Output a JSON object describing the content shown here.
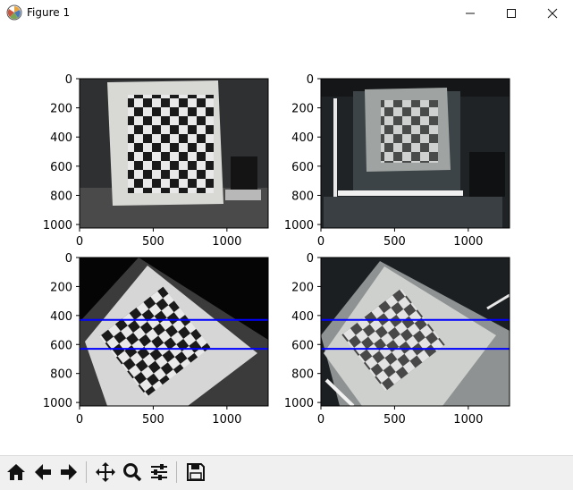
{
  "window": {
    "title": "Figure 1",
    "minimize_icon": "minimize-icon",
    "maximize_icon": "maximize-icon",
    "close_icon": "close-icon"
  },
  "figure": {
    "subplots": [
      {
        "id": "top-left",
        "xticks": [
          "0",
          "500",
          "1000"
        ],
        "yticks": [
          "0",
          "200",
          "400",
          "600",
          "800",
          "1000"
        ],
        "lines": []
      },
      {
        "id": "top-right",
        "xticks": [
          "0",
          "500",
          "1000"
        ],
        "yticks": [
          "0",
          "200",
          "400",
          "600",
          "800",
          "1000"
        ],
        "lines": []
      },
      {
        "id": "bottom-left",
        "xticks": [
          "0",
          "500",
          "1000"
        ],
        "yticks": [
          "0",
          "200",
          "400",
          "600",
          "800",
          "1000"
        ],
        "lines": [
          {
            "y": 430,
            "color": "#0000ff"
          },
          {
            "y": 630,
            "color": "#0000ff"
          }
        ]
      },
      {
        "id": "bottom-right",
        "xticks": [
          "0",
          "500",
          "1000"
        ],
        "yticks": [
          "0",
          "200",
          "400",
          "600",
          "800",
          "1000"
        ],
        "lines": [
          {
            "y": 430,
            "color": "#0000ff"
          },
          {
            "y": 630,
            "color": "#0000ff"
          }
        ]
      }
    ],
    "image_extent": {
      "x": [
        0,
        1280
      ],
      "y": [
        0,
        1024
      ]
    }
  },
  "toolbar": {
    "buttons": [
      {
        "name": "home-button",
        "icon": "home-icon"
      },
      {
        "name": "back-button",
        "icon": "back-arrow-icon"
      },
      {
        "name": "forward-button",
        "icon": "forward-arrow-icon"
      },
      {
        "name": "pan-button",
        "icon": "move-icon"
      },
      {
        "name": "zoom-button",
        "icon": "magnifier-icon"
      },
      {
        "name": "configure-subplots-button",
        "icon": "sliders-icon"
      },
      {
        "name": "save-button",
        "icon": "floppy-icon"
      }
    ]
  }
}
